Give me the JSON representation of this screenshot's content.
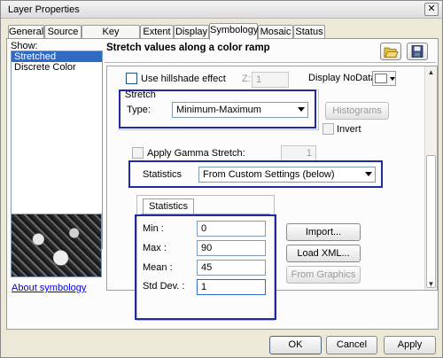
{
  "window": {
    "title": "Layer Properties",
    "close_glyph": "✕"
  },
  "tabs": [
    {
      "label": "General"
    },
    {
      "label": "Source"
    },
    {
      "label": "Key Metadata"
    },
    {
      "label": "Extent"
    },
    {
      "label": "Display"
    },
    {
      "label": "Symbology",
      "active": true
    },
    {
      "label": "Mosaic"
    },
    {
      "label": "Status"
    }
  ],
  "show": {
    "label": "Show:",
    "items": [
      {
        "label": "Stretched",
        "selected": true
      },
      {
        "label": "Discrete Color"
      }
    ],
    "about_link": "About symbology"
  },
  "panel": {
    "heading": "Stretch values along a color ramp",
    "open_icon": "folder-open-icon",
    "save_icon": "save-icon"
  },
  "hillshade": {
    "label": "Use hillshade effect",
    "z_label": "Z:",
    "z_value": "1"
  },
  "nodata": {
    "label": "Display NoData as"
  },
  "stretch": {
    "group_label": "Stretch",
    "type_label": "Type:",
    "type_value": "Minimum-Maximum",
    "histograms_label": "Histograms",
    "invert_label": "Invert"
  },
  "gamma": {
    "label": "Apply Gamma Stretch:",
    "value": "1"
  },
  "statistics": {
    "label": "Statistics",
    "value": "From Custom Settings (below)",
    "tab_label": "Statistics",
    "min_label": "Min :",
    "min_value": "0",
    "max_label": "Max :",
    "max_value": "90",
    "mean_label": "Mean :",
    "mean_value": "45",
    "std_label": "Std Dev. :",
    "std_value": "1",
    "import_label": "Import...",
    "load_xml_label": "Load XML...",
    "from_graphics_label": "From Graphics"
  },
  "footer": {
    "ok": "OK",
    "cancel": "Cancel",
    "apply": "Apply"
  },
  "colors": {
    "highlight": "#1f2aa5",
    "selection": "#316ac5"
  }
}
